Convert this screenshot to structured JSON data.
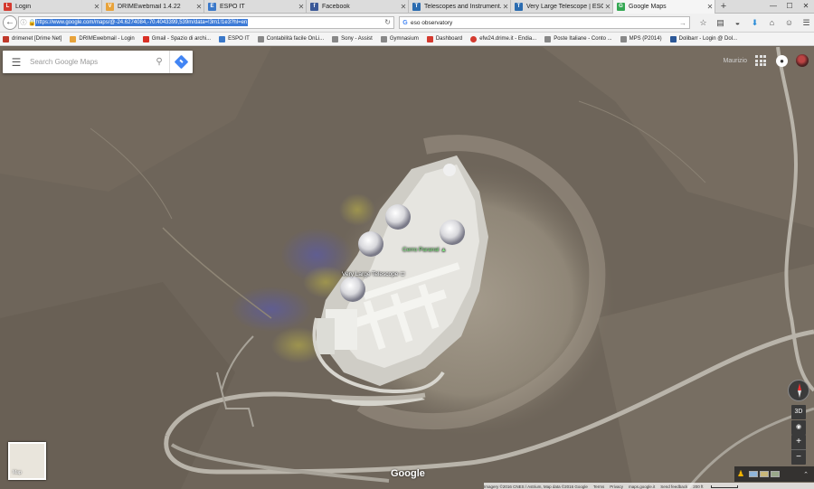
{
  "browser": {
    "tabs": [
      {
        "title": "Login",
        "icon": "L",
        "color": "#d43a2f",
        "active": false
      },
      {
        "title": "DRIMEwebmail 1.4.22",
        "icon": "V",
        "color": "#e8a33b",
        "active": false
      },
      {
        "title": "ESPO IT",
        "icon": "E",
        "color": "#3a78c9",
        "active": false
      },
      {
        "title": "Facebook",
        "icon": "f",
        "color": "#3b5998",
        "active": false
      },
      {
        "title": "Telescopes and Instrument...",
        "icon": "T",
        "color": "#2b6cb0",
        "active": false
      },
      {
        "title": "Very Large Telescope | ESO",
        "icon": "T",
        "color": "#2b6cb0",
        "active": false
      },
      {
        "title": "Google Maps",
        "icon": "G",
        "color": "#34a853",
        "active": true
      }
    ],
    "new_tab": "+",
    "window_controls": {
      "minimize": "—",
      "maximize": "☐",
      "close": "✕"
    },
    "url": "https://www.google.com/maps/@-24.6274084,-70.4043399,539m/data=!3m1!1e3?hl=en",
    "search_value": "eso observatory",
    "bookmarks": [
      {
        "label": "drimenet [Drime Net]",
        "color": "#c0392b"
      },
      {
        "label": "DRIMEwebmail - Login",
        "color": "#e8a33b"
      },
      {
        "label": "Gmail - Spazio di archi...",
        "color": "#d93025"
      },
      {
        "label": "ESPO IT",
        "color": "#3a78c9"
      },
      {
        "label": "Contabilità facile OnLi...",
        "color": "#888888"
      },
      {
        "label": "Sony - Assist",
        "color": "#888888"
      },
      {
        "label": "Gymnasium",
        "color": "#888888"
      },
      {
        "label": "Dashboard",
        "color": "#d43a2f"
      },
      {
        "label": "efw24.drime.it - Endia...",
        "color": "#d43a2f"
      },
      {
        "label": "Poste Italiane - Conto ...",
        "color": "#888888"
      },
      {
        "label": "MPS (P2014)",
        "color": "#888888"
      },
      {
        "label": "Dolibarr - Login @ Dol...",
        "color": "#2b5797"
      }
    ]
  },
  "maps": {
    "search_placeholder": "Search Google Maps",
    "user_name": "Maurizio",
    "poi_labels": [
      {
        "label": "Cerro Paranal",
        "type": "peak"
      },
      {
        "label": "Very Large Telescope",
        "type": "landmark"
      }
    ],
    "logo": "Google",
    "minimap_label": "Map",
    "tilt_label": "3D",
    "zoom_in": "+",
    "zoom_out": "−",
    "attribution": [
      "Imagery ©2016 CNES / Astrium, Map data ©2016 Google",
      "Terms",
      "Privacy",
      "maps.google.it",
      "Send feedback",
      "200 ft"
    ],
    "colors": {
      "terrain": "#6e655a",
      "road": "#b9b4aa",
      "platform": "#eeeeea"
    }
  }
}
